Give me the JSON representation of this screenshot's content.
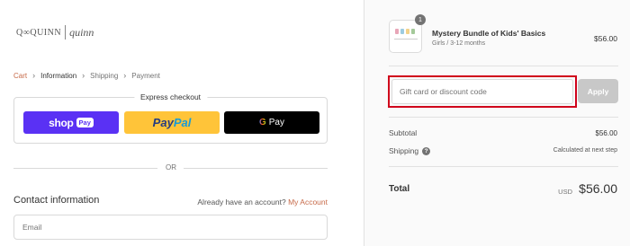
{
  "logo": {
    "left": "Q∞QUINN",
    "right": "quinn"
  },
  "breadcrumb": [
    "Cart",
    "Information",
    "Shipping",
    "Payment"
  ],
  "express": {
    "title": "Express checkout",
    "shop_pay": {
      "shop": "shop",
      "pay": "Pay"
    },
    "paypal": {
      "pay": "Pay",
      "pal": "Pal"
    },
    "gpay": {
      "g": "G",
      "pay": "Pay"
    }
  },
  "divider_text": "OR",
  "contact": {
    "title": "Contact information",
    "account_prompt": "Already have an account?",
    "account_link": "My Account",
    "email_placeholder": "Email"
  },
  "cart": {
    "quantity": "1",
    "product_name": "Mystery Bundle of Kids' Basics",
    "variant": "Girls / 3-12 months",
    "price": "$56.00"
  },
  "discount": {
    "placeholder": "Gift card or discount code",
    "apply_label": "Apply",
    "highlight_color": "#d0021b"
  },
  "summary": {
    "subtotal_label": "Subtotal",
    "subtotal_value": "$56.00",
    "shipping_label": "Shipping",
    "shipping_value": "Calculated at next step",
    "total_label": "Total",
    "currency": "USD",
    "total_value": "$56.00"
  },
  "colors": {
    "link": "#c76b4a",
    "shop_pay": "#5a31f4",
    "paypal": "#ffc439",
    "gpay": "#000000"
  }
}
